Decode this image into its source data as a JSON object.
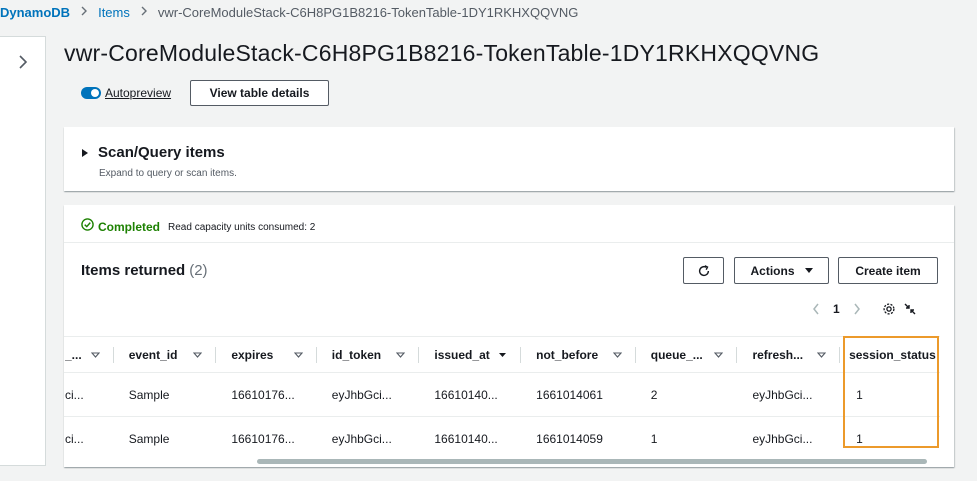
{
  "breadcrumb": {
    "root": "DynamoDB",
    "items": "Items",
    "current": "vwr-CoreModuleStack-C6H8PG1B8216-TokenTable-1DY1RKHXQQVNG"
  },
  "page": {
    "title": "vwr-CoreModuleStack-C6H8PG1B8216-TokenTable-1DY1RKHXQQVNG",
    "autopreview_label": "Autopreview",
    "autopreview_on": true,
    "view_details_label": "View table details"
  },
  "scan": {
    "title": "Scan/Query items",
    "description": "Expand to query or scan items."
  },
  "results": {
    "status": "Completed",
    "capacity": "Read capacity units consumed: 2",
    "title": "Items returned",
    "count": "(2)",
    "actions_label": "Actions",
    "create_label": "Create item",
    "page_number": "1"
  },
  "table": {
    "columns": [
      "_...",
      "event_id",
      "expires",
      "id_token",
      "issued_at",
      "not_before",
      "queue_...",
      "refresh...",
      "session_status"
    ],
    "sorted_column": "issued_at",
    "rows": [
      [
        "ci...",
        "Sample",
        "16610176...",
        "eyJhbGci...",
        "16610140...",
        "1661014061",
        "2",
        "eyJhbGci...",
        "1"
      ],
      [
        "ci...",
        "Sample",
        "16610176...",
        "eyJhbGci...",
        "16610140...",
        "1661014059",
        "1",
        "eyJhbGci...",
        "1"
      ]
    ]
  },
  "colors": {
    "link": "#0073bb",
    "success": "#1d8102",
    "highlight": "#ec9a2b"
  }
}
